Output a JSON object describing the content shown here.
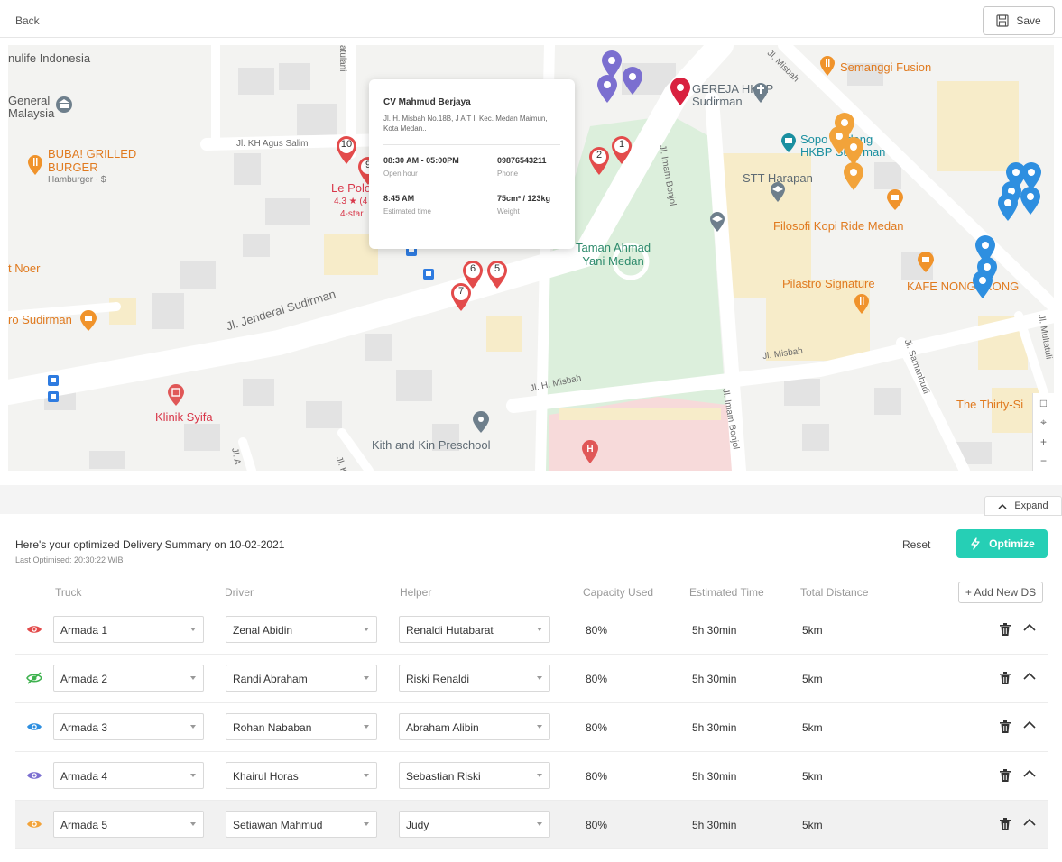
{
  "header": {
    "back_label": "Back",
    "save_label": "Save"
  },
  "map": {
    "labels": {
      "nulife": "nulife Indonesia",
      "general_malaysia": "General\nMalaysia",
      "buba": "BUBA! GRILLED\nBURGER",
      "buba_sub": "Hamburger · $",
      "le_polo": "Le Polo",
      "le_polo_rating": "4.3 ★ (4",
      "le_polo_star": "4-star",
      "noer": "t Noer",
      "ro_sudirman": "ro Sudirman",
      "klinik": "Klinik Syifa",
      "kith": "Kith and Kin Preschool",
      "taman": "Taman Ahmad\nYani Medan",
      "gereja": "GEREJA HKBP\nSudirman",
      "semanggi": "Semanggi Fusion",
      "sopo": "Sopo Godang\nHKBP Sudirman",
      "stt": "STT Harapan",
      "filosofi": "Filosofi Kopi Ride Medan",
      "pilastro": "Pilastro Signature",
      "kafe": "KAFE NONGKRONG",
      "thirty": "The Thirty-Si",
      "r_kh": "Jl. KH Agus Salim",
      "r_sud": "Jl. Jenderal Sudirman",
      "r_misbah_a": "Jl. Misbah",
      "r_misbah_b": "Jl. Misbah",
      "r_misbah_c": "Jl. H. Misbah",
      "r_imam_a": "Jl. Imam Bonjol",
      "r_imam_b": "Jl. Imam Bonjol",
      "r_samanhudi": "Jl. Samanhudi",
      "r_multatuli": "Jl. Multatuli",
      "r_ltulani": "atulani",
      "r_ja": "Jl. A",
      "r_jk": "Jl. K"
    },
    "pin_numbers": [
      "10",
      "9",
      "2",
      "1",
      "6",
      "5",
      "7"
    ],
    "popup": {
      "name": "CV Mahmud Berjaya",
      "address": "Jl. H. Misbah No.18B, J A T I, Kec. Medan Maimun, Kota Medan..",
      "open_hour": "08:30 AM - 05:00PM",
      "open_hour_label": "Open hour",
      "phone": "09876543211",
      "phone_label": "Phone",
      "est_time": "8:45 AM",
      "est_time_label": "Estimated time",
      "weight": "75cm³ / 123kg",
      "weight_label": "Weight"
    },
    "controls": {
      "square": "□",
      "locate": "⌖",
      "zoom_in": "+",
      "zoom_out": "−"
    }
  },
  "expand_label": "Expand",
  "summary": {
    "title": "Here's your optimized Delivery Summary on 10-02-2021",
    "last_optimised": "Last Optimised:  20:30:22 WIB",
    "reset_label": "Reset",
    "optimize_label": "Optimize",
    "add_new_label": "+ Add New DS"
  },
  "table": {
    "headers": [
      "Truck",
      "Driver",
      "Helper",
      "Capacity Used",
      "Estimated Time",
      "Total Distance"
    ],
    "rows": [
      {
        "truck": "Armada 1",
        "driver": "Zenal Abidin",
        "helper": "Renaldi Hutabarat",
        "capacity": "80%",
        "time": "5h 30min",
        "distance": "5km",
        "eye_color": "#e34b4b",
        "hidden": false
      },
      {
        "truck": "Armada 2",
        "driver": "Randi Abraham",
        "helper": "Riski Renaldi",
        "capacity": "80%",
        "time": "5h 30min",
        "distance": "5km",
        "eye_color": "#3fb24f",
        "hidden": true
      },
      {
        "truck": "Armada 3",
        "driver": "Rohan Nababan",
        "helper": "Abraham Alibin",
        "capacity": "80%",
        "time": "5h 30min",
        "distance": "5km",
        "eye_color": "#2e8fe0",
        "hidden": false
      },
      {
        "truck": "Armada 4",
        "driver": "Khairul Horas",
        "helper": "Sebastian Riski",
        "capacity": "80%",
        "time": "5h 30min",
        "distance": "5km",
        "eye_color": "#7b6fd0",
        "hidden": false
      },
      {
        "truck": "Armada 5",
        "driver": "Setiawan Mahmud",
        "helper": "Judy",
        "capacity": "80%",
        "time": "5h 30min",
        "distance": "5km",
        "eye_color": "#f2a33a",
        "hidden": false
      }
    ]
  },
  "colors": {
    "accent": "#26cfb5",
    "pin_red": "#e34b4b",
    "pin_purple": "#7b6fd0",
    "pin_orange": "#f2a33a",
    "pin_blue": "#2e8fe0"
  }
}
